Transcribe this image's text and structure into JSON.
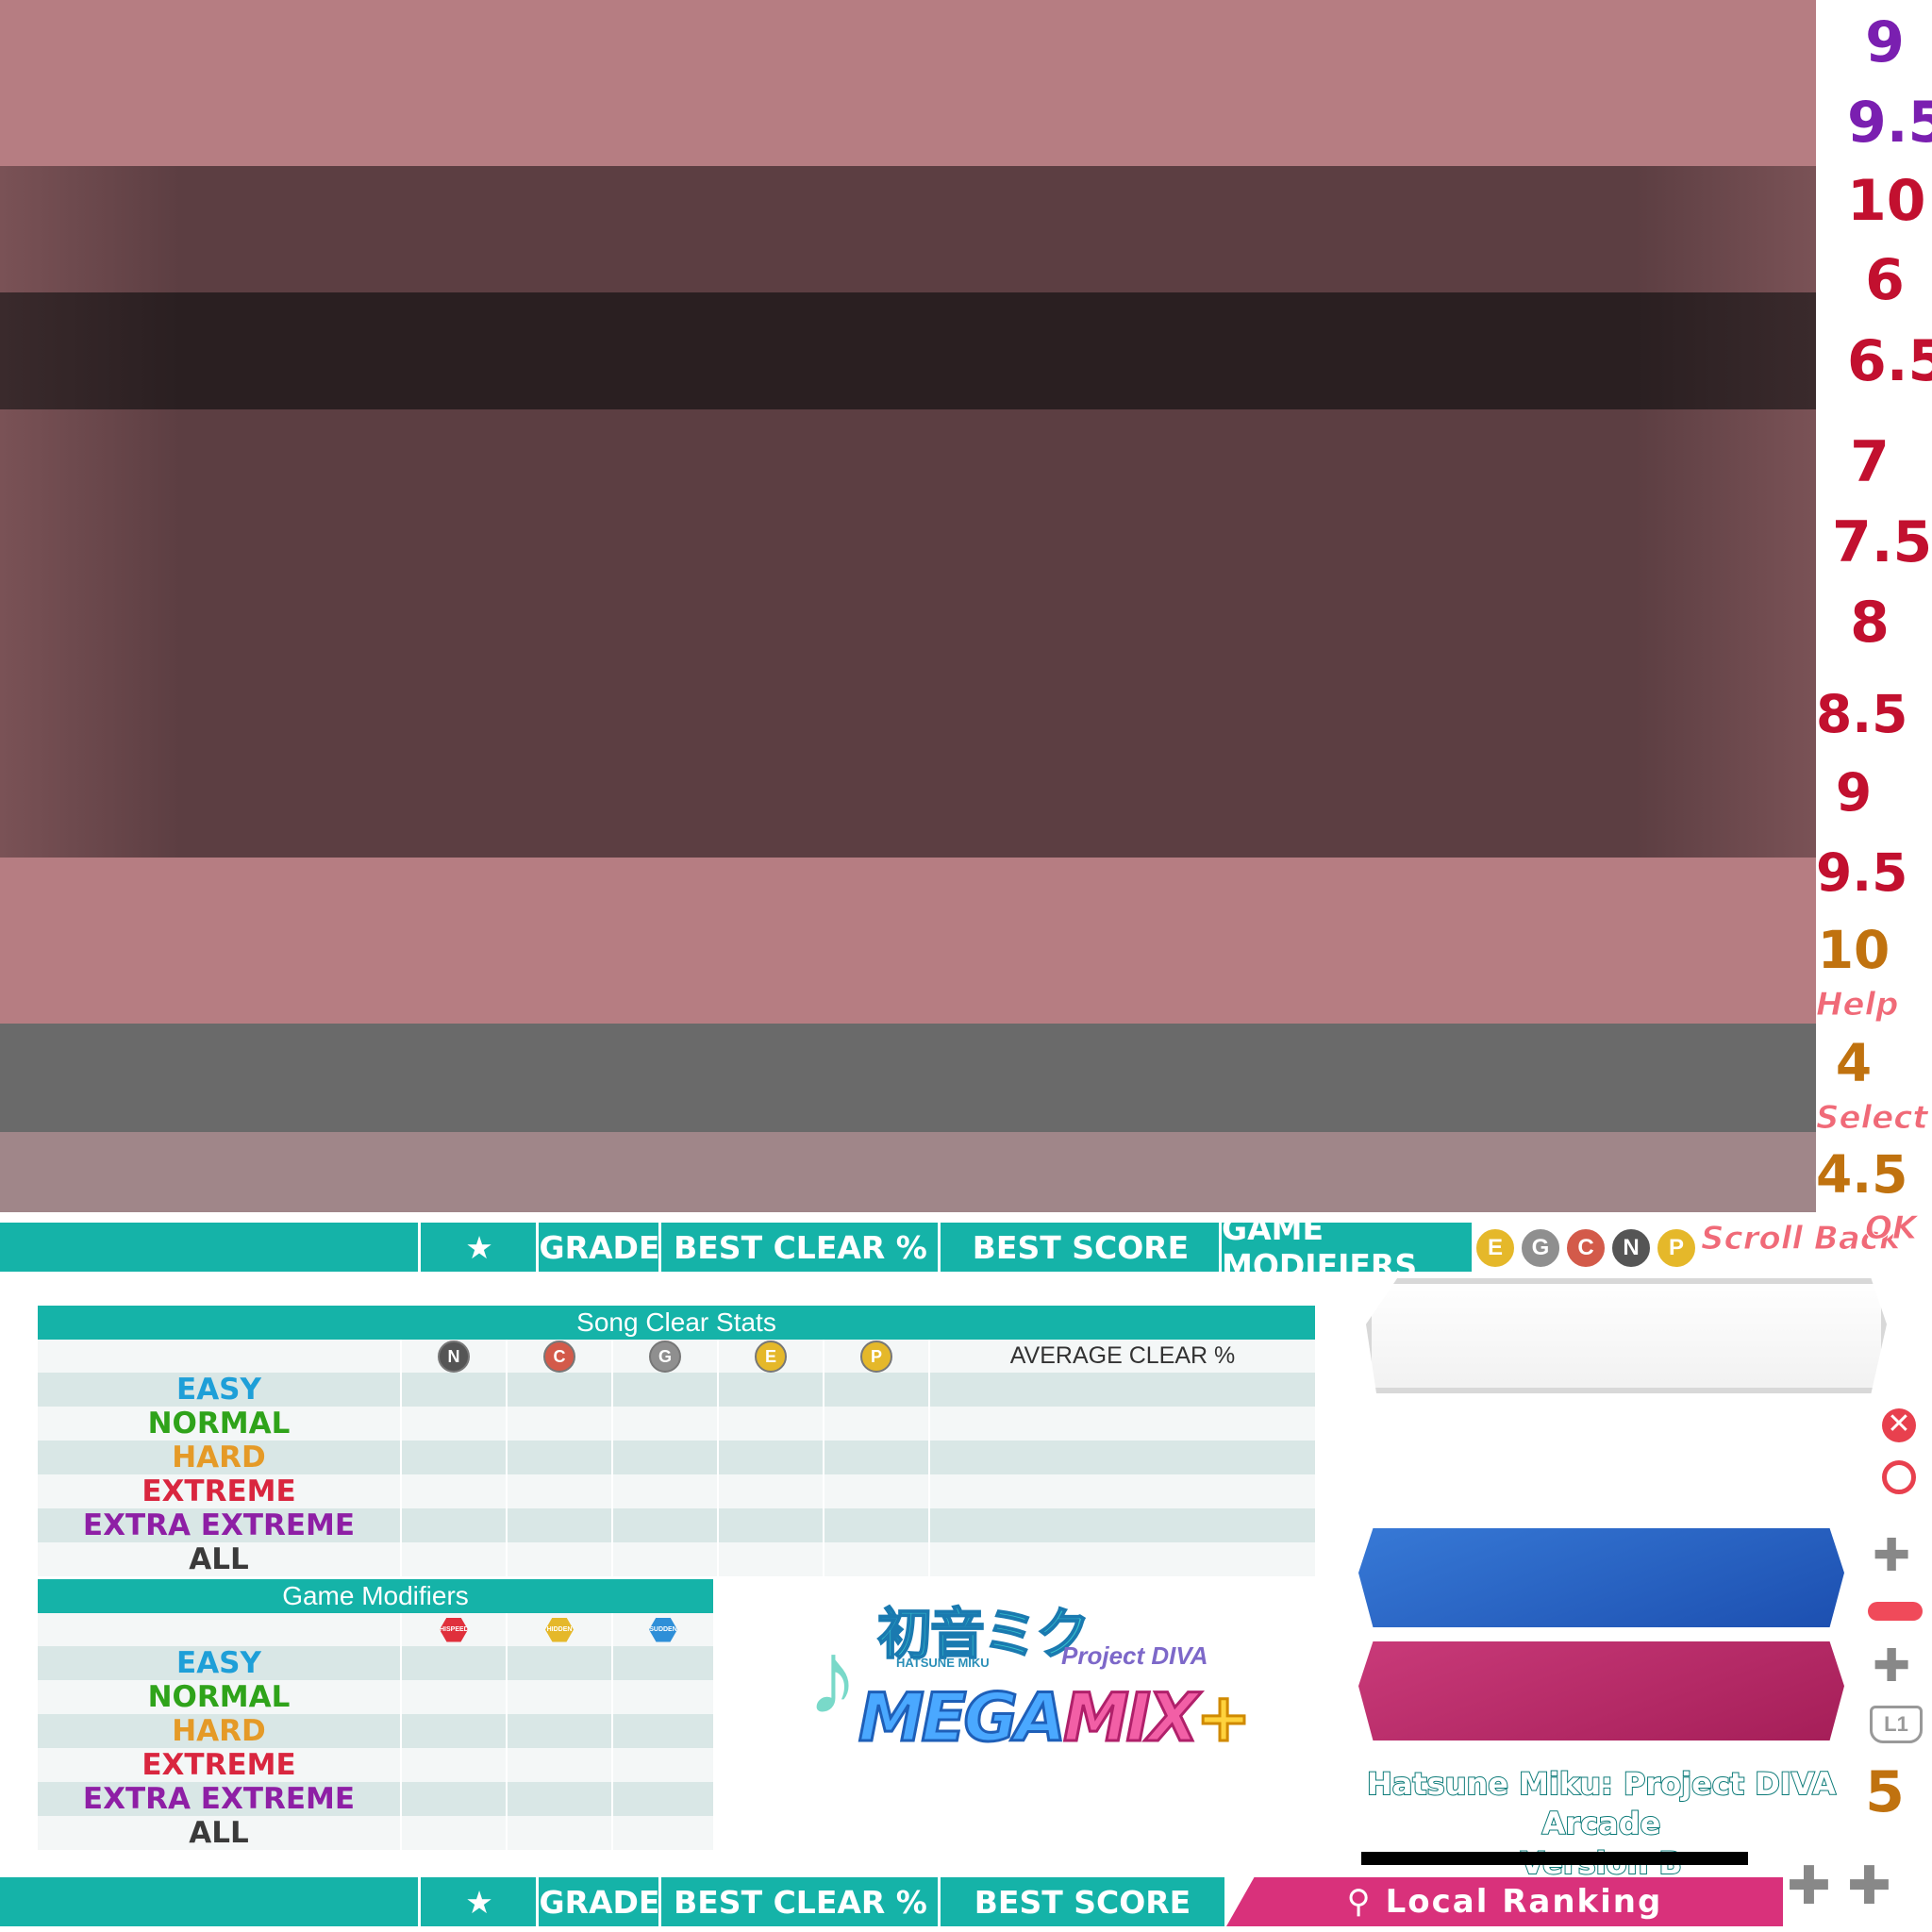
{
  "right_column": {
    "numbers": [
      {
        "value": "9",
        "color": "#7a1fb0"
      },
      {
        "value": "9.5",
        "color": "#7a1fb0"
      },
      {
        "value": "10",
        "color": "#c2102f"
      },
      {
        "value": "6",
        "color": "#c2102f"
      },
      {
        "value": "6.5",
        "color": "#c2102f"
      },
      {
        "value": "7",
        "color": "#c2102f"
      },
      {
        "value": "7.5",
        "color": "#c2102f"
      },
      {
        "value": "8",
        "color": "#c2102f"
      },
      {
        "value": "8.5",
        "color": "#c2102f"
      },
      {
        "value": "9",
        "color": "#c2102f"
      },
      {
        "value": "9.5",
        "color": "#c2102f"
      },
      {
        "value": "10",
        "color": "#c0720f"
      },
      {
        "value": "4",
        "color": "#c0720f"
      },
      {
        "value": "4.5",
        "color": "#c0720f"
      },
      {
        "value": "5",
        "color": "#c0720f"
      }
    ],
    "labels": {
      "help": "Help",
      "select": "Select",
      "scroll_back": "Scroll Back",
      "ok": "OK"
    }
  },
  "header_top": {
    "star": "★",
    "grade": "GRADE",
    "best_clear": "BEST CLEAR %",
    "best_score": "BEST SCORE",
    "game_modifiers": "GAME MODIFIERS"
  },
  "coins": [
    "E",
    "G",
    "C",
    "N",
    "P"
  ],
  "song_clear_stats": {
    "title": "Song Clear Stats",
    "medals": [
      "N",
      "C",
      "G",
      "E",
      "P"
    ],
    "average_label": "AVERAGE CLEAR %",
    "rows": [
      "EASY",
      "NORMAL",
      "HARD",
      "EXTREME",
      "EXTRA EXTREME",
      "ALL"
    ]
  },
  "game_modifiers_table": {
    "title": "Game Modifiers",
    "badges": [
      "HISPEED",
      "HIDDEN",
      "SUDDEN"
    ],
    "rows": [
      "EASY",
      "NORMAL",
      "HARD",
      "EXTREME",
      "EXTRA EXTREME",
      "ALL"
    ]
  },
  "difficulty_colors": {
    "EASY": "#1e9fd8",
    "NORMAL": "#2fa31a",
    "HARD": "#e59a27",
    "EXTREME": "#d9263f",
    "EXTRA EXTREME": "#8e1fa5",
    "ALL": "#3a3a3a"
  },
  "logo": {
    "jp": "初音ミク",
    "sub": "HATSUNE MIKU",
    "project": "Project DIVA",
    "mega": "MEGA",
    "mix": "MIX",
    "plus": "+"
  },
  "arcade_title": {
    "line1": "Hatsune Miku: Project DIVA Arcade",
    "line2": "Version B"
  },
  "header_bottom": {
    "star": "★",
    "grade": "GRADE",
    "best_clear": "BEST CLEAR %",
    "best_score": "BEST SCORE",
    "local_ranking": "Local Ranking"
  },
  "colors": {
    "teal": "#15b3a8",
    "pink_bg": "#b67d82",
    "dark_bg": "#5c3e42",
    "darkest_bg": "#2a1f21",
    "gray": "#6a6a6a"
  }
}
